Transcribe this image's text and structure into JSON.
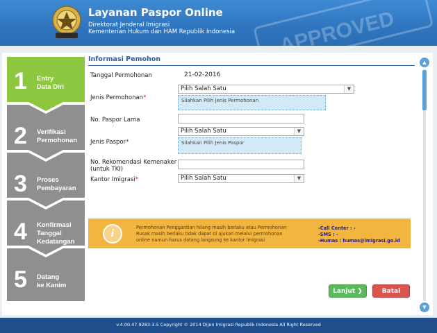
{
  "header": {
    "title": "Layanan Paspor Online",
    "subtitle_line1": "Direktorat Jenderal Imigrasi",
    "subtitle_line2": "Kementerian Hukum dan HAM Republik Indonesia",
    "logo_text": "IMIGRASI",
    "stamp_text": "APPROVED"
  },
  "steps": [
    {
      "number": "1",
      "label1": "Entry",
      "label2": "Data Diri",
      "label3": "",
      "active": true
    },
    {
      "number": "2",
      "label1": "Verifikasi",
      "label2": "Permohonan",
      "label3": "",
      "active": false
    },
    {
      "number": "3",
      "label1": "Proses",
      "label2": "Pembayaran",
      "label3": "",
      "active": false
    },
    {
      "number": "4",
      "label1": "Konfirmasi",
      "label2": "Tanggal",
      "label3": "Kedatangan",
      "active": false
    },
    {
      "number": "5",
      "label1": "Datang",
      "label2": "ke Kanim",
      "label3": "",
      "active": false
    }
  ],
  "form": {
    "section_title": "Informasi Pemohon",
    "tanggal_label": "Tanggal Permohonan",
    "tanggal_value": "21-02-2016",
    "jenis_permohonan_label": "Jenis Permohonan",
    "jenis_permohonan_value": "Pilih Salah Satu",
    "jenis_permohonan_hint": "Silahkan Pilih Jenis Permohonan",
    "paspor_lama_label": "No. Paspor Lama",
    "jenis_paspor_label": "Jenis Paspor",
    "jenis_paspor_value": "Pilih Salah Satu",
    "jenis_paspor_hint": "Silahkan Pilih Jenis Paspor",
    "rekomendasi_label1": "No. Rekomendasi Kemenaker",
    "rekomendasi_label2": "(untuk TKI)",
    "kantor_label": "Kantor Imigrasi",
    "kantor_value": "Pilih Salah Satu",
    "required_mark": "*"
  },
  "info": {
    "icon": "i",
    "line1": "Permohonan Penggantian hilang masih berlaku atau Permohonan",
    "line2": "Rusak masih berlaku tidak dapat di ajukan melalui permohonan",
    "line3": "online namun harus datang langsung ke kantor Imigrasi",
    "call_center": "-Call Center : -",
    "sms": "-SMS : -",
    "humas": "-Humas : humas@imigrasi.go.id"
  },
  "buttons": {
    "next": "Lanjut",
    "next_icon": "❯",
    "cancel": "Batal"
  },
  "footer": {
    "text": "v.4.00.47.9283-3.5 Copyright © 2014 Dijen Imigrasi Republik Indonesia All Right Reserved"
  },
  "colors": {
    "header_blue": "#2f75bf",
    "step_active": "#8dc63f",
    "step_inactive": "#8f8f8f",
    "info_bar": "#f2b640",
    "next_button": "#5cb85c",
    "cancel_button": "#d9534f",
    "footer_blue": "#1e4e8c"
  },
  "icons": {
    "scroll_up": "chevron-up-icon",
    "scroll_down": "chevron-down-icon",
    "info": "info-icon",
    "next_arrow": "chevron-right-icon"
  }
}
